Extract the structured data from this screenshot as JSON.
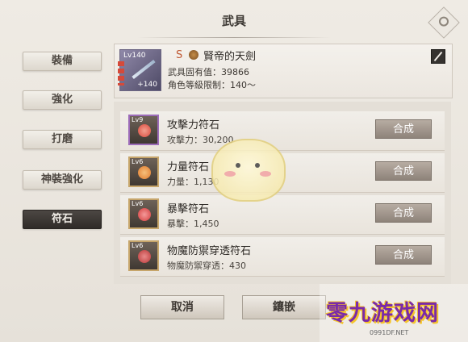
{
  "header": {
    "title": "武具"
  },
  "tabs": [
    {
      "label": "裝備",
      "active": false
    },
    {
      "label": "強化",
      "active": false
    },
    {
      "label": "打磨",
      "active": false
    },
    {
      "label": "神裝強化",
      "active": false
    },
    {
      "label": "符石",
      "active": true
    }
  ],
  "weapon": {
    "level": "Lv140",
    "enhance": "+140",
    "rank": "S",
    "name": "賢帝的天劍",
    "fixed_value": "武具固有值：39866",
    "level_limit": "角色等級限制：140～"
  },
  "stones": [
    {
      "level": "Lv9",
      "name": "攻擊力符石",
      "value": "攻擊力：30,200",
      "button": "合成",
      "gem_color": "#d8473c",
      "frame": "purple"
    },
    {
      "level": "Lv6",
      "name": "力量符石",
      "value": "力量：1,130",
      "button": "合成",
      "gem_color": "#e07a2c",
      "frame": "gold"
    },
    {
      "level": "Lv6",
      "name": "暴擊符石",
      "value": "暴擊：1,450",
      "button": "合成",
      "gem_color": "#d23b3b",
      "frame": "gold"
    },
    {
      "level": "Lv6",
      "name": "物魔防禦穿透符石",
      "value": "物魔防禦穿透：430",
      "button": "合成",
      "gem_color": "#b93838",
      "frame": "gold"
    }
  ],
  "actions": {
    "cancel": "取消",
    "inlay": "鑲嵌"
  },
  "watermark": {
    "text": "零九游戏网",
    "url": "0991DF.NET"
  }
}
